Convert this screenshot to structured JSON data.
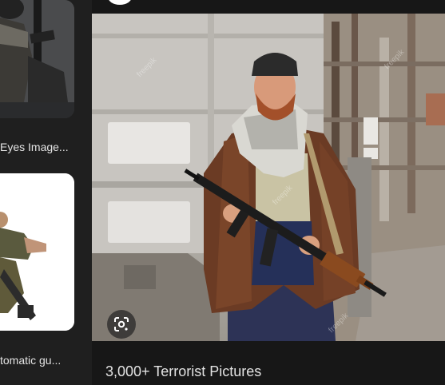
{
  "results": [
    {
      "caption": "Eyes Image...",
      "image": "armed-man-thumbnail"
    },
    {
      "caption": "tomatic gu...",
      "image": "man-with-rifle-thumbnail"
    }
  ],
  "preview": {
    "image_alt": "man-with-assault-rifle-in-ruins",
    "title": "3,000+ Terrorist Pictures",
    "lens_icon": "google-lens-icon"
  },
  "colors": {
    "background": "#1f1f1f",
    "panel": "#171717",
    "text": "#e3e3e3"
  }
}
